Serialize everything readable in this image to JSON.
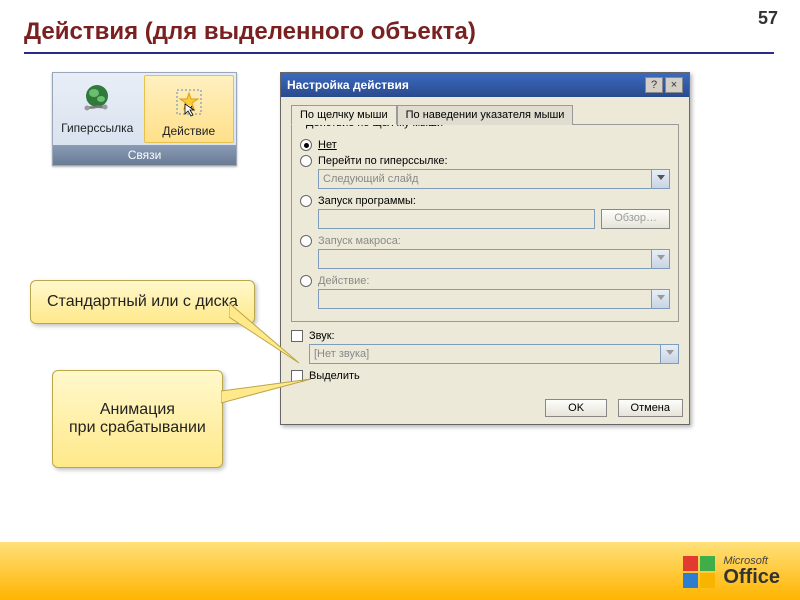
{
  "page_number": "57",
  "title": "Действия (для выделенного объекта)",
  "ribbon": {
    "items": [
      {
        "label": "Гиперссылка"
      },
      {
        "label": "Действие"
      }
    ],
    "group": "Связи"
  },
  "dialog": {
    "title": "Настройка действия",
    "help": "?",
    "close": "×",
    "tabs": [
      "По щелчку мыши",
      "По наведении указателя мыши"
    ],
    "fieldset": "Действие по щелчку мыши",
    "opts": {
      "none": "Нет",
      "hyperlink": "Перейти по гиперссылке:",
      "hyperlink_sel": "Следующий слайд",
      "run_program": "Запуск программы:",
      "browse": "Обзор…",
      "run_macro": "Запуск макроса:",
      "action": "Действие:",
      "sound": "Звук:",
      "sound_sel": "[Нет звука]",
      "highlight": "Выделить"
    },
    "ok": "OK",
    "cancel": "Отмена"
  },
  "callouts": {
    "sound": "Стандартный или с диска",
    "highlight": "Анимация\nпри срабатывании"
  },
  "brand": {
    "ms": "Microsoft",
    "office": "Office"
  }
}
